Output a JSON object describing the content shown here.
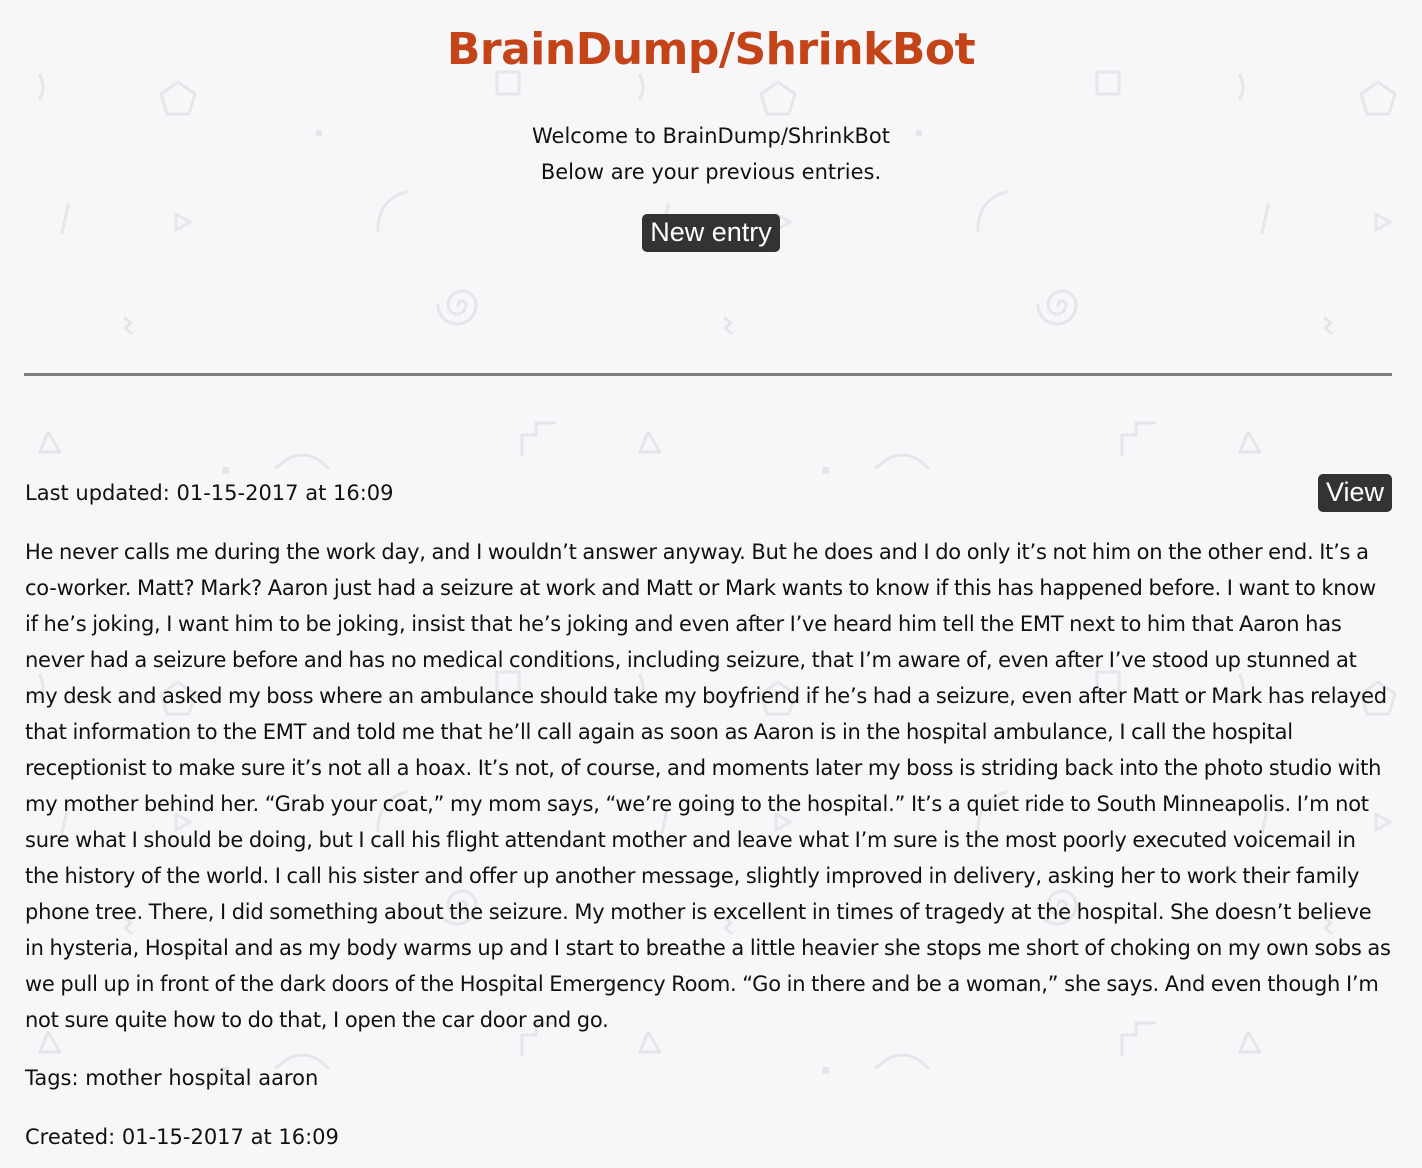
{
  "header": {
    "title": "BrainDump/ShrinkBot",
    "welcome_line1": "Welcome to BrainDump/ShrinkBot",
    "welcome_line2": "Below are your previous entries.",
    "new_entry_label": "New entry"
  },
  "entries": [
    {
      "last_updated": "Last updated: 01-15-2017 at 16:09",
      "view_label": "View",
      "body": "He never calls me during the work day, and I wouldn’t answer anyway. But he does and I do only it’s not him on the other end. It’s a co-worker. Matt? Mark? Aaron just had a seizure at work and Matt or Mark wants to know if this has happened before. I want to know if he’s joking, I want him to be joking, insist that he’s joking and even after I’ve heard him tell the EMT next to him that Aaron has never had a seizure before and has no medical conditions, including seizure, that I’m aware of, even after I’ve stood up stunned at my desk and asked my boss where an ambulance should take my boyfriend if he’s had a seizure, even after Matt or Mark has relayed that information to the EMT and told me that he’ll call again as soon as Aaron is in the hospital ambulance, I call the hospital receptionist to make sure it’s not all a hoax. It’s not, of course, and moments later my boss is striding back into the photo studio with my mother behind her. “Grab your coat,” my mom says, “we’re going to the hospital.” It’s a quiet ride to South Minneapolis. I’m not sure what I should be doing, but I call his flight attendant mother and leave what I’m sure is the most poorly executed voicemail in the history of the world. I call his sister and offer up another message, slightly improved in delivery, asking her to work their family phone tree. There, I did something about the seizure. My mother is excellent in times of tragedy at the hospital. She doesn’t believe in hysteria, Hospital and as my body warms up and I start to breathe a little heavier she stops me short of choking on my own sobs as we pull up in front of the dark doors of the Hospital Emergency Room. “Go in there and be a woman,” she says. And even though I’m not sure quite how to do that, I open the car door and go.",
      "tags": "Tags: mother hospital aaron",
      "created": "Created: 01-15-2017 at 16:09"
    }
  ],
  "colors": {
    "title": "#c4441a",
    "button_bg": "#333333",
    "button_text": "#ffffff",
    "divider": "#808080",
    "background": "#f7f7f9"
  }
}
